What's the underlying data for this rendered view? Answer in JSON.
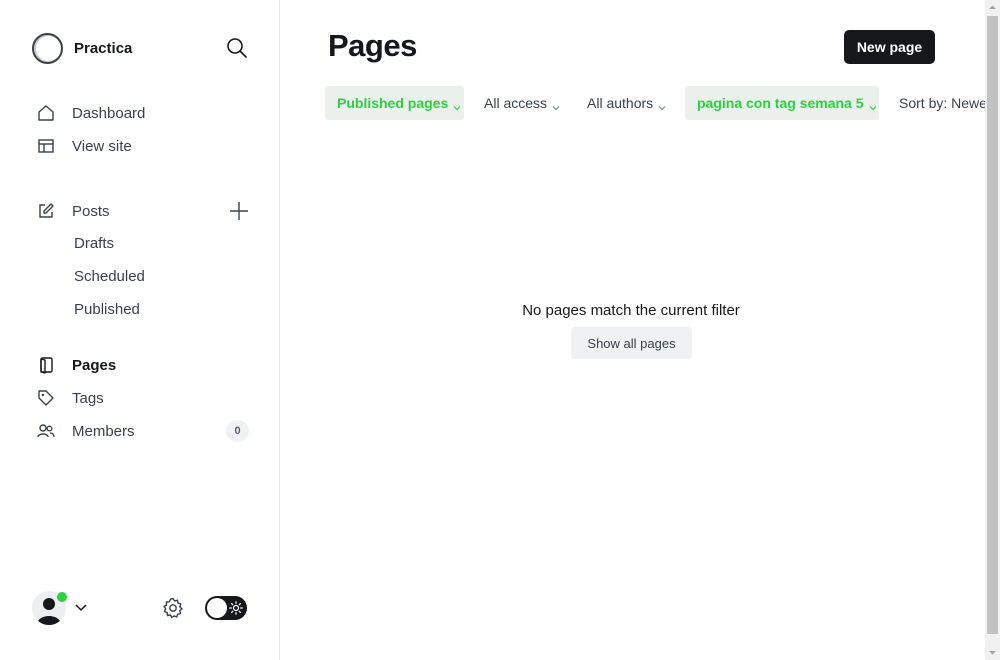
{
  "brand": {
    "name": "Practica"
  },
  "nav": {
    "dashboard": "Dashboard",
    "view_site": "View site",
    "posts": "Posts",
    "drafts": "Drafts",
    "scheduled": "Scheduled",
    "published": "Published",
    "pages": "Pages",
    "tags": "Tags",
    "members": "Members",
    "members_count": "0"
  },
  "main": {
    "title": "Pages",
    "new_page_label": "New page",
    "filters": {
      "type": "Published pages",
      "access": "All access",
      "authors": "All authors",
      "tag": "pagina con tag semana 5",
      "sort": "Sort by: Newest"
    },
    "empty_message": "No pages match the current filter",
    "show_all_label": "Show all pages"
  },
  "colors": {
    "accent": "#30cf43",
    "dark": "#15171a"
  },
  "icons": [
    "search-icon",
    "home-icon",
    "layout-icon",
    "edit-icon",
    "plus-icon",
    "page-icon",
    "tag-icon",
    "members-icon",
    "chevron-down-icon",
    "gear-icon",
    "sun-icon"
  ]
}
